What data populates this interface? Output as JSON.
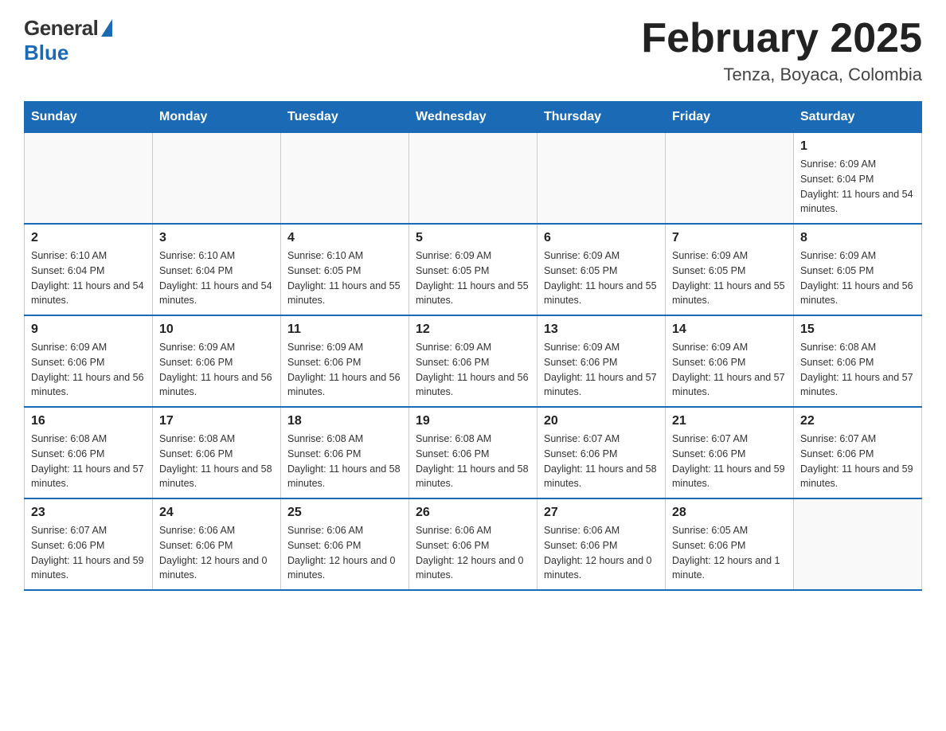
{
  "logo": {
    "general": "General",
    "blue": "Blue"
  },
  "header": {
    "month_year": "February 2025",
    "location": "Tenza, Boyaca, Colombia"
  },
  "days_of_week": [
    "Sunday",
    "Monday",
    "Tuesday",
    "Wednesday",
    "Thursday",
    "Friday",
    "Saturday"
  ],
  "weeks": [
    [
      {
        "day": "",
        "sunrise": "",
        "sunset": "",
        "daylight": ""
      },
      {
        "day": "",
        "sunrise": "",
        "sunset": "",
        "daylight": ""
      },
      {
        "day": "",
        "sunrise": "",
        "sunset": "",
        "daylight": ""
      },
      {
        "day": "",
        "sunrise": "",
        "sunset": "",
        "daylight": ""
      },
      {
        "day": "",
        "sunrise": "",
        "sunset": "",
        "daylight": ""
      },
      {
        "day": "",
        "sunrise": "",
        "sunset": "",
        "daylight": ""
      },
      {
        "day": "1",
        "sunrise": "Sunrise: 6:09 AM",
        "sunset": "Sunset: 6:04 PM",
        "daylight": "Daylight: 11 hours and 54 minutes."
      }
    ],
    [
      {
        "day": "2",
        "sunrise": "Sunrise: 6:10 AM",
        "sunset": "Sunset: 6:04 PM",
        "daylight": "Daylight: 11 hours and 54 minutes."
      },
      {
        "day": "3",
        "sunrise": "Sunrise: 6:10 AM",
        "sunset": "Sunset: 6:04 PM",
        "daylight": "Daylight: 11 hours and 54 minutes."
      },
      {
        "day": "4",
        "sunrise": "Sunrise: 6:10 AM",
        "sunset": "Sunset: 6:05 PM",
        "daylight": "Daylight: 11 hours and 55 minutes."
      },
      {
        "day": "5",
        "sunrise": "Sunrise: 6:09 AM",
        "sunset": "Sunset: 6:05 PM",
        "daylight": "Daylight: 11 hours and 55 minutes."
      },
      {
        "day": "6",
        "sunrise": "Sunrise: 6:09 AM",
        "sunset": "Sunset: 6:05 PM",
        "daylight": "Daylight: 11 hours and 55 minutes."
      },
      {
        "day": "7",
        "sunrise": "Sunrise: 6:09 AM",
        "sunset": "Sunset: 6:05 PM",
        "daylight": "Daylight: 11 hours and 55 minutes."
      },
      {
        "day": "8",
        "sunrise": "Sunrise: 6:09 AM",
        "sunset": "Sunset: 6:05 PM",
        "daylight": "Daylight: 11 hours and 56 minutes."
      }
    ],
    [
      {
        "day": "9",
        "sunrise": "Sunrise: 6:09 AM",
        "sunset": "Sunset: 6:06 PM",
        "daylight": "Daylight: 11 hours and 56 minutes."
      },
      {
        "day": "10",
        "sunrise": "Sunrise: 6:09 AM",
        "sunset": "Sunset: 6:06 PM",
        "daylight": "Daylight: 11 hours and 56 minutes."
      },
      {
        "day": "11",
        "sunrise": "Sunrise: 6:09 AM",
        "sunset": "Sunset: 6:06 PM",
        "daylight": "Daylight: 11 hours and 56 minutes."
      },
      {
        "day": "12",
        "sunrise": "Sunrise: 6:09 AM",
        "sunset": "Sunset: 6:06 PM",
        "daylight": "Daylight: 11 hours and 56 minutes."
      },
      {
        "day": "13",
        "sunrise": "Sunrise: 6:09 AM",
        "sunset": "Sunset: 6:06 PM",
        "daylight": "Daylight: 11 hours and 57 minutes."
      },
      {
        "day": "14",
        "sunrise": "Sunrise: 6:09 AM",
        "sunset": "Sunset: 6:06 PM",
        "daylight": "Daylight: 11 hours and 57 minutes."
      },
      {
        "day": "15",
        "sunrise": "Sunrise: 6:08 AM",
        "sunset": "Sunset: 6:06 PM",
        "daylight": "Daylight: 11 hours and 57 minutes."
      }
    ],
    [
      {
        "day": "16",
        "sunrise": "Sunrise: 6:08 AM",
        "sunset": "Sunset: 6:06 PM",
        "daylight": "Daylight: 11 hours and 57 minutes."
      },
      {
        "day": "17",
        "sunrise": "Sunrise: 6:08 AM",
        "sunset": "Sunset: 6:06 PM",
        "daylight": "Daylight: 11 hours and 58 minutes."
      },
      {
        "day": "18",
        "sunrise": "Sunrise: 6:08 AM",
        "sunset": "Sunset: 6:06 PM",
        "daylight": "Daylight: 11 hours and 58 minutes."
      },
      {
        "day": "19",
        "sunrise": "Sunrise: 6:08 AM",
        "sunset": "Sunset: 6:06 PM",
        "daylight": "Daylight: 11 hours and 58 minutes."
      },
      {
        "day": "20",
        "sunrise": "Sunrise: 6:07 AM",
        "sunset": "Sunset: 6:06 PM",
        "daylight": "Daylight: 11 hours and 58 minutes."
      },
      {
        "day": "21",
        "sunrise": "Sunrise: 6:07 AM",
        "sunset": "Sunset: 6:06 PM",
        "daylight": "Daylight: 11 hours and 59 minutes."
      },
      {
        "day": "22",
        "sunrise": "Sunrise: 6:07 AM",
        "sunset": "Sunset: 6:06 PM",
        "daylight": "Daylight: 11 hours and 59 minutes."
      }
    ],
    [
      {
        "day": "23",
        "sunrise": "Sunrise: 6:07 AM",
        "sunset": "Sunset: 6:06 PM",
        "daylight": "Daylight: 11 hours and 59 minutes."
      },
      {
        "day": "24",
        "sunrise": "Sunrise: 6:06 AM",
        "sunset": "Sunset: 6:06 PM",
        "daylight": "Daylight: 12 hours and 0 minutes."
      },
      {
        "day": "25",
        "sunrise": "Sunrise: 6:06 AM",
        "sunset": "Sunset: 6:06 PM",
        "daylight": "Daylight: 12 hours and 0 minutes."
      },
      {
        "day": "26",
        "sunrise": "Sunrise: 6:06 AM",
        "sunset": "Sunset: 6:06 PM",
        "daylight": "Daylight: 12 hours and 0 minutes."
      },
      {
        "day": "27",
        "sunrise": "Sunrise: 6:06 AM",
        "sunset": "Sunset: 6:06 PM",
        "daylight": "Daylight: 12 hours and 0 minutes."
      },
      {
        "day": "28",
        "sunrise": "Sunrise: 6:05 AM",
        "sunset": "Sunset: 6:06 PM",
        "daylight": "Daylight: 12 hours and 1 minute."
      },
      {
        "day": "",
        "sunrise": "",
        "sunset": "",
        "daylight": ""
      }
    ]
  ]
}
